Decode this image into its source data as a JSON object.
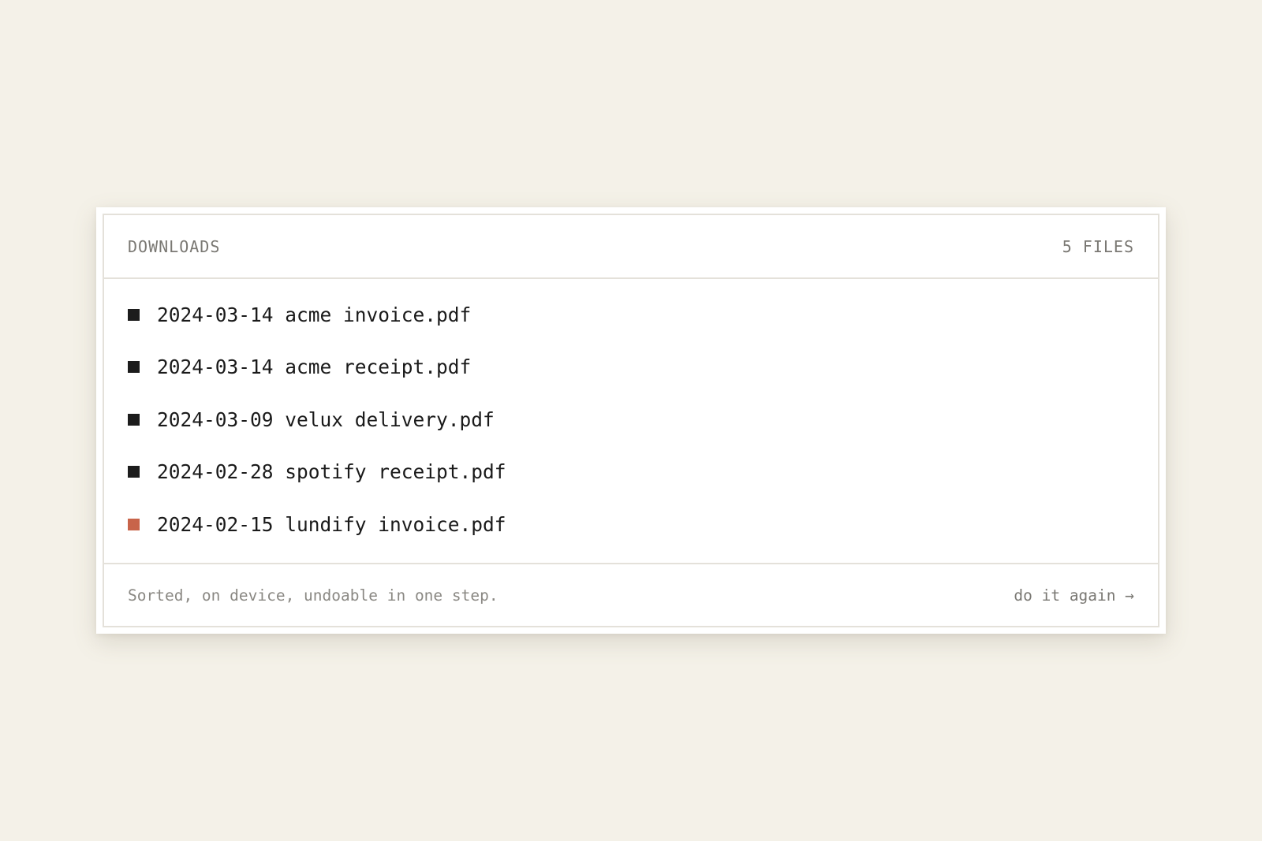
{
  "panel": {
    "title": "DOWNLOADS",
    "count": "5 FILES"
  },
  "files": [
    {
      "name": "2024-03-14 acme invoice.pdf",
      "marker": "file-marker-square-icon",
      "marker_color": "#1c1c1c"
    },
    {
      "name": "2024-03-14 acme receipt.pdf",
      "marker": "file-marker-square-icon",
      "marker_color": "#1c1c1c"
    },
    {
      "name": "2024-03-09 velux delivery.pdf",
      "marker": "file-marker-square-icon",
      "marker_color": "#1c1c1c"
    },
    {
      "name": "2024-02-28 spotify receipt.pdf",
      "marker": "file-marker-square-icon",
      "marker_color": "#1c1c1c"
    },
    {
      "name": "2024-02-15 lundify invoice.pdf",
      "marker": "file-marker-square-icon",
      "marker_color": "#c8644a"
    }
  ],
  "footer": {
    "note": "Sorted, on device, undoable in one step.",
    "action": "do it again →"
  },
  "colors": {
    "background": "#f4f1e8",
    "accent": "#c8644a",
    "text": "#1a1a1a",
    "muted": "#7a7873"
  }
}
